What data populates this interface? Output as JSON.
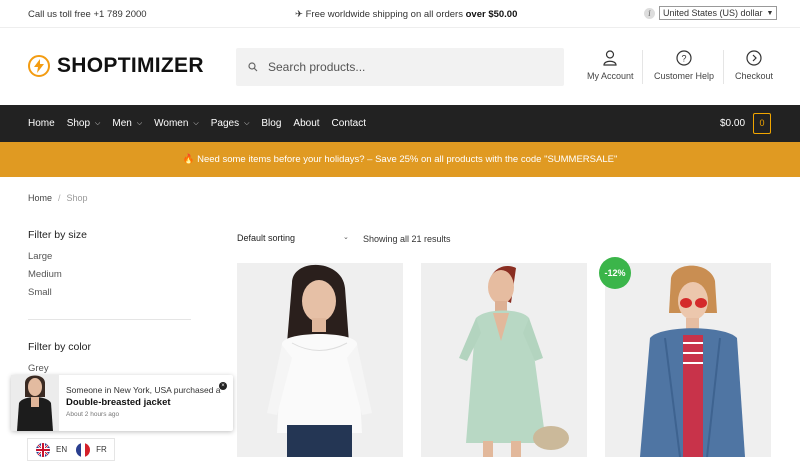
{
  "topbar": {
    "phone": "Call us toll free +1 789 2000",
    "shipping_prefix": "✈ Free worldwide shipping on all orders",
    "shipping_amount": "over $50.00",
    "info_glyph": "i",
    "currency": "United States (US) dollar"
  },
  "header": {
    "logo": "SHOPTIMIZER",
    "search_placeholder": "Search products...",
    "my_account": "My Account",
    "customer_help": "Customer Help",
    "checkout": "Checkout"
  },
  "nav": {
    "items": [
      {
        "label": "Home",
        "dropdown": false
      },
      {
        "label": "Shop",
        "dropdown": true
      },
      {
        "label": "Men",
        "dropdown": true
      },
      {
        "label": "Women",
        "dropdown": true
      },
      {
        "label": "Pages",
        "dropdown": true
      },
      {
        "label": "Blog",
        "dropdown": false
      },
      {
        "label": "About",
        "dropdown": false
      },
      {
        "label": "Contact",
        "dropdown": false
      }
    ],
    "cart_total": "$0.00",
    "cart_count": "0"
  },
  "promo": "🔥 Need some items before your holidays? – Save 25% on all products with the code \"SUMMERSALE\"",
  "breadcrumb": {
    "home": "Home",
    "current": "Shop"
  },
  "filters": {
    "size_title": "Filter by size",
    "sizes": [
      "Large",
      "Medium",
      "Small"
    ],
    "color_title": "Filter by color",
    "colors": [
      "Grey"
    ]
  },
  "toolbar": {
    "sorting": "Default sorting",
    "results": "Showing all 21 results"
  },
  "products": [
    {
      "badge": ""
    },
    {
      "badge": ""
    },
    {
      "badge": "-12%"
    }
  ],
  "popup": {
    "line1": "Someone in New York, USA purchased a",
    "product": "Double-breasted jacket",
    "time": "About 2 hours ago"
  },
  "languages": [
    "EN",
    "FR"
  ],
  "colors": {
    "accent": "#f39c12",
    "nav_bg": "#222222",
    "promo_bg": "#e09a22",
    "sale_badge": "#3bb54a"
  }
}
